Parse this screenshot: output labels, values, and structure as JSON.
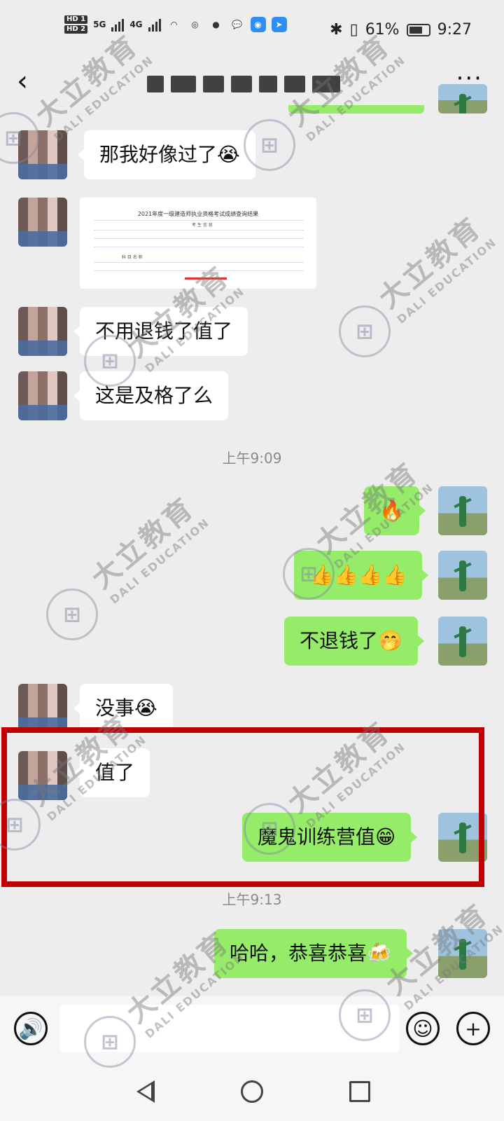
{
  "status_bar": {
    "hd1": "HD 1",
    "hd2": "HD 2",
    "net1": "5G",
    "net2": "4G",
    "battery": "61%",
    "time": "9:27"
  },
  "header": {
    "back_icon": "chevron-left-icon",
    "title": "",
    "more_icon": "more-icon"
  },
  "messages": [
    {
      "side": "left",
      "text": "那我好像过了😭"
    },
    {
      "side": "left",
      "type": "image",
      "doc_title": "2021年度一级建造师执业资格考试成绩查询结果",
      "doc_header": "考 生 信 息",
      "doc_subheader": "科 目 名 称"
    },
    {
      "side": "left",
      "text": "不用退钱了值了"
    },
    {
      "side": "left",
      "text": "这是及格了么"
    },
    {
      "type": "time",
      "text": "上午9:09"
    },
    {
      "side": "right",
      "text": "🔥"
    },
    {
      "side": "right",
      "text": "👍👍👍👍"
    },
    {
      "side": "right",
      "text": "不退钱了🤭"
    },
    {
      "side": "left",
      "text": "没事😭"
    },
    {
      "side": "left",
      "text": "值了"
    },
    {
      "side": "right",
      "text": "魔鬼训练营值😁"
    },
    {
      "type": "time",
      "text": "上午9:13"
    },
    {
      "side": "right",
      "text": "哈哈，恭喜恭喜🍻"
    }
  ],
  "input_bar": {
    "voice_icon": "voice-icon",
    "emoji_icon": "emoji-icon",
    "plus_icon": "plus-icon",
    "placeholder": ""
  },
  "nav_bar": {
    "back": "nav-back-icon",
    "home": "nav-home-icon",
    "recent": "nav-recent-icon"
  },
  "watermark": {
    "cn": "大立教育",
    "en": "DALI EDUCATION"
  },
  "colors": {
    "bg": "#ededed",
    "left_bubble": "#ffffff",
    "right_bubble": "#95ec69",
    "highlight": "#c00000"
  }
}
